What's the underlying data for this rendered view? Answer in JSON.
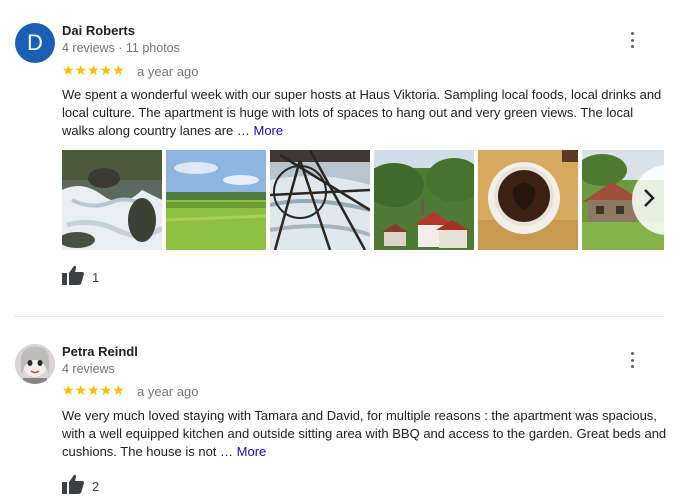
{
  "reviews": [
    {
      "name": "Dai Roberts",
      "avatar_letter": "D",
      "meta": "4 reviews · 11 photos",
      "stars": "★★★★★",
      "rating": 5,
      "date": "a year ago",
      "text": "We spent a wonderful week with our super hosts at Haus Viktoria. Sampling local foods, local drinks and local culture. The apartment is huge with lots of spaces to hang out and very green views. The local walks along country lanes are …",
      "more_label": "More",
      "likes": "1",
      "photos": [
        "waterfall-photo",
        "meadow-photo",
        "river-through-window-photo",
        "village-photo",
        "coffee-cup-photo",
        "farmhouse-photo"
      ]
    },
    {
      "name": "Petra Reindl",
      "meta": "4 reviews",
      "stars": "★★★★★",
      "rating": 5,
      "date": "a year ago",
      "text": "We very much loved staying with Tamara and David, for multiple reasons : the apartment was spacious, with a well equipped kitchen and outside sitting area with BBQ and access to the  garden. Great beds and cushions. The house is not …",
      "more_label": "More",
      "likes": "2"
    }
  ],
  "colors": {
    "star": "#fbbc04",
    "link": "#1a0dab",
    "avatar_bg": "#1a5fb4",
    "muted": "#70757a"
  },
  "icons": {
    "menu": "more-vert-icon",
    "like": "thumb-up-icon",
    "next": "chevron-right-icon"
  }
}
